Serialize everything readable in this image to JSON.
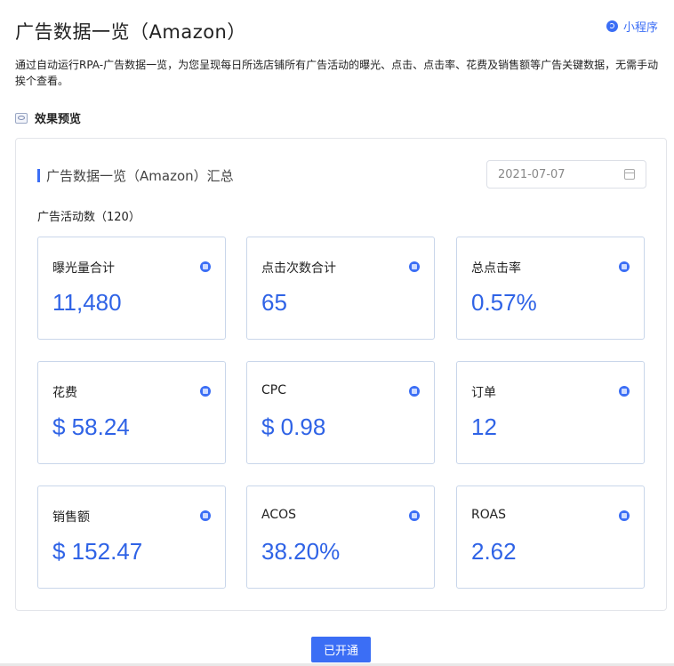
{
  "header": {
    "title": "广告数据一览（Amazon）",
    "mini_program": "小程序",
    "description": "通过自动运行RPA-广告数据一览，为您呈现每日所选店铺所有广告活动的曝光、点击、点击率、花费及销售额等广告关键数据，无需手动挨个查看。",
    "preview_label": "效果预览"
  },
  "panel": {
    "title": "广告数据一览（Amazon）汇总",
    "date": "2021-07-07",
    "campaign_count": "广告活动数（120）"
  },
  "cards": [
    {
      "label": "曝光量合计",
      "value": "11,480",
      "icon": "image-icon"
    },
    {
      "label": "点击次数合计",
      "value": "65",
      "icon": "click-icon"
    },
    {
      "label": "总点击率",
      "value": "0.57%",
      "icon": "rate-icon"
    },
    {
      "label": "花费",
      "value": "$ 58.24",
      "icon": "spend-icon"
    },
    {
      "label": "CPC",
      "value": "$ 0.98",
      "icon": "cpc-icon"
    },
    {
      "label": "订单",
      "value": "12",
      "icon": "order-icon"
    },
    {
      "label": "销售额",
      "value": "$ 152.47",
      "icon": "sales-icon"
    },
    {
      "label": "ACOS",
      "value": "38.20%",
      "icon": "acos-icon"
    },
    {
      "label": "ROAS",
      "value": "2.62",
      "icon": "roas-icon"
    }
  ],
  "footer": {
    "button_label": "已开通"
  },
  "colors": {
    "accent": "#3b6ef5",
    "value_text": "#2f63e6"
  }
}
